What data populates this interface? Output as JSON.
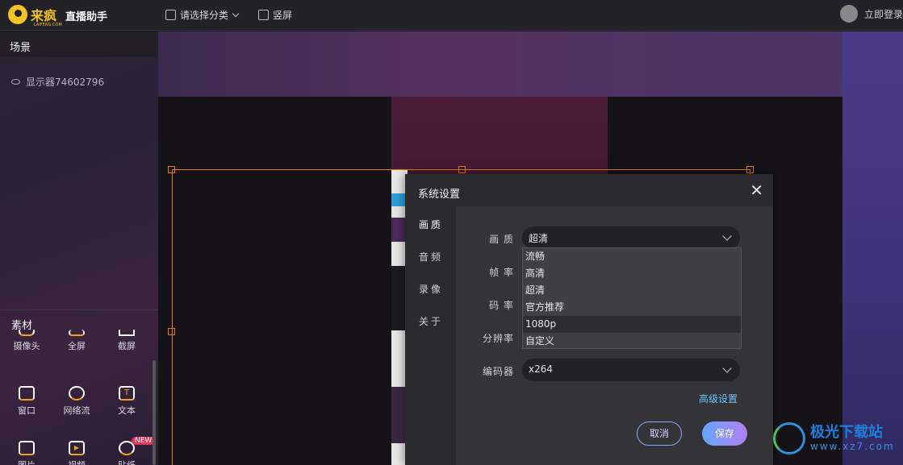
{
  "app": {
    "logo_text": "来疯",
    "logo_sub": "LAIFENG.COM",
    "title": "直播助手",
    "category_label": "请选择分类",
    "orientation_label": "竖屏",
    "login_label": "立即登录"
  },
  "scenes": {
    "header": "场景",
    "items": [
      {
        "label": "显示器74602796"
      }
    ]
  },
  "materials": {
    "header": "素材",
    "items": [
      {
        "label": "摄像头",
        "icon": "camera-icon"
      },
      {
        "label": "全屏",
        "icon": "fullscreen-icon"
      },
      {
        "label": "截屏",
        "icon": "screenshot-icon"
      },
      {
        "label": "窗口",
        "icon": "window-icon"
      },
      {
        "label": "网络流",
        "icon": "globe-icon"
      },
      {
        "label": "文本",
        "icon": "text-icon"
      },
      {
        "label": "图片",
        "icon": "image-icon"
      },
      {
        "label": "视频",
        "icon": "video-icon"
      },
      {
        "label": "贴纸",
        "icon": "sticker-icon",
        "badge": "NEW"
      }
    ]
  },
  "dialog": {
    "title": "系统设置",
    "close_icon": "close-icon",
    "nav": [
      {
        "label": "画质",
        "active": true
      },
      {
        "label": "音频",
        "active": false
      },
      {
        "label": "录像",
        "active": false
      },
      {
        "label": "关于",
        "active": false
      }
    ],
    "rows": {
      "quality_label": "画 质",
      "quality_value": "超清",
      "framerate_label": "帧 率",
      "bitrate_label": "码 率",
      "resolution_label": "分辨率",
      "encoder_label": "编码器",
      "encoder_value": "x264"
    },
    "quality_options": [
      "流畅",
      "高清",
      "超清",
      "官方推荐",
      "1080p",
      "自定义"
    ],
    "hovered_option_index": 4,
    "advanced_link": "高级设置",
    "cancel_label": "取消",
    "save_label": "保存"
  },
  "watermark": {
    "title": "极光下载站",
    "url": "www.xz7.com"
  },
  "colors": {
    "accent_orange": "#e07b17",
    "brand_yellow": "#f3c224",
    "link_blue": "#6ec4ff",
    "badge_red": "#e8345a"
  }
}
